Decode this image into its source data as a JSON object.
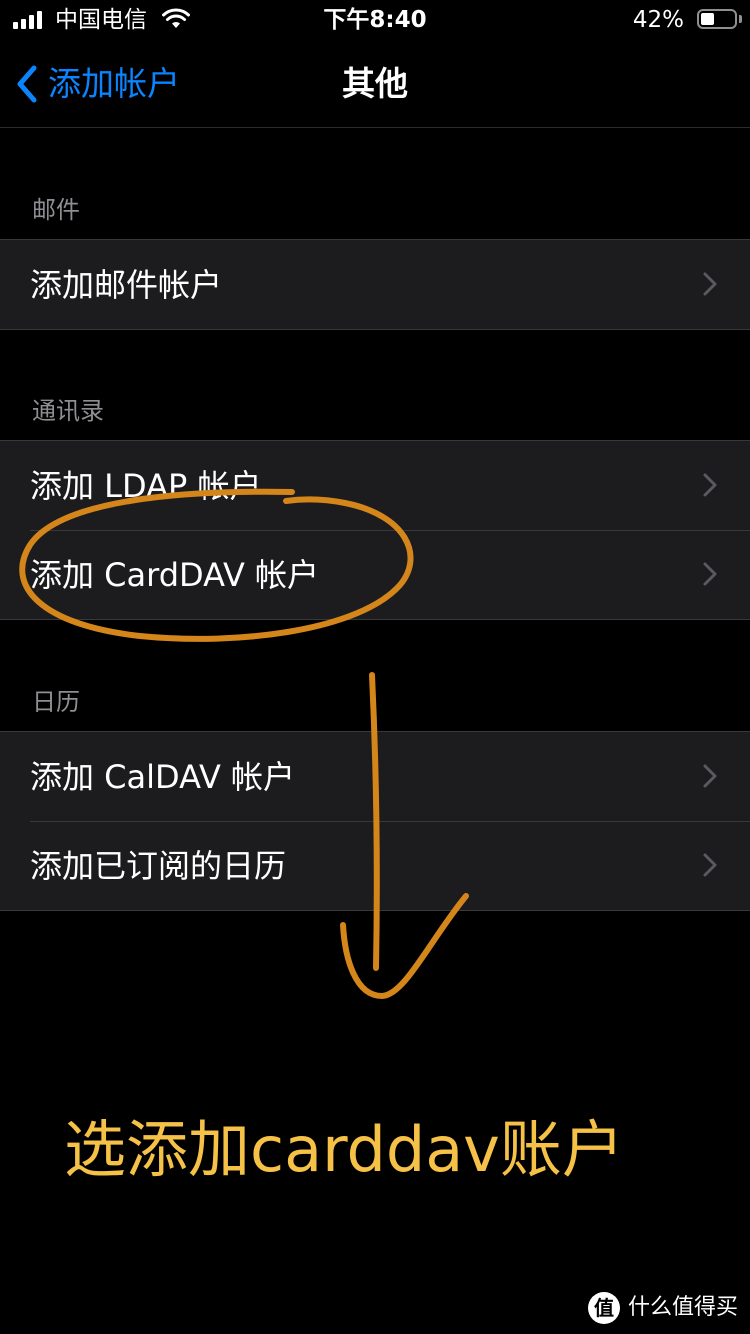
{
  "status_bar": {
    "carrier": "中国电信",
    "time": "下午8:40",
    "battery_percent": "42%",
    "battery_level": 0.42
  },
  "nav": {
    "back_label": "添加帐户",
    "title": "其他"
  },
  "sections": {
    "mail": {
      "header": "邮件",
      "items": [
        "添加邮件帐户"
      ]
    },
    "contacts": {
      "header": "通讯录",
      "items": [
        "添加 LDAP 帐户",
        "添加 CardDAV 帐户"
      ]
    },
    "calendar": {
      "header": "日历",
      "items": [
        "添加 CalDAV 帐户",
        "添加已订阅的日历"
      ]
    }
  },
  "annotation": {
    "text": "选添加carddav账户",
    "color": "#f5c146",
    "stroke_color": "#d4861a"
  },
  "watermark": {
    "logo_char": "值",
    "text": "什么值得买"
  },
  "colors": {
    "accent": "#0a84ff",
    "background": "#000000",
    "cell": "#1c1c1e",
    "secondary_text": "#8e8e93"
  }
}
